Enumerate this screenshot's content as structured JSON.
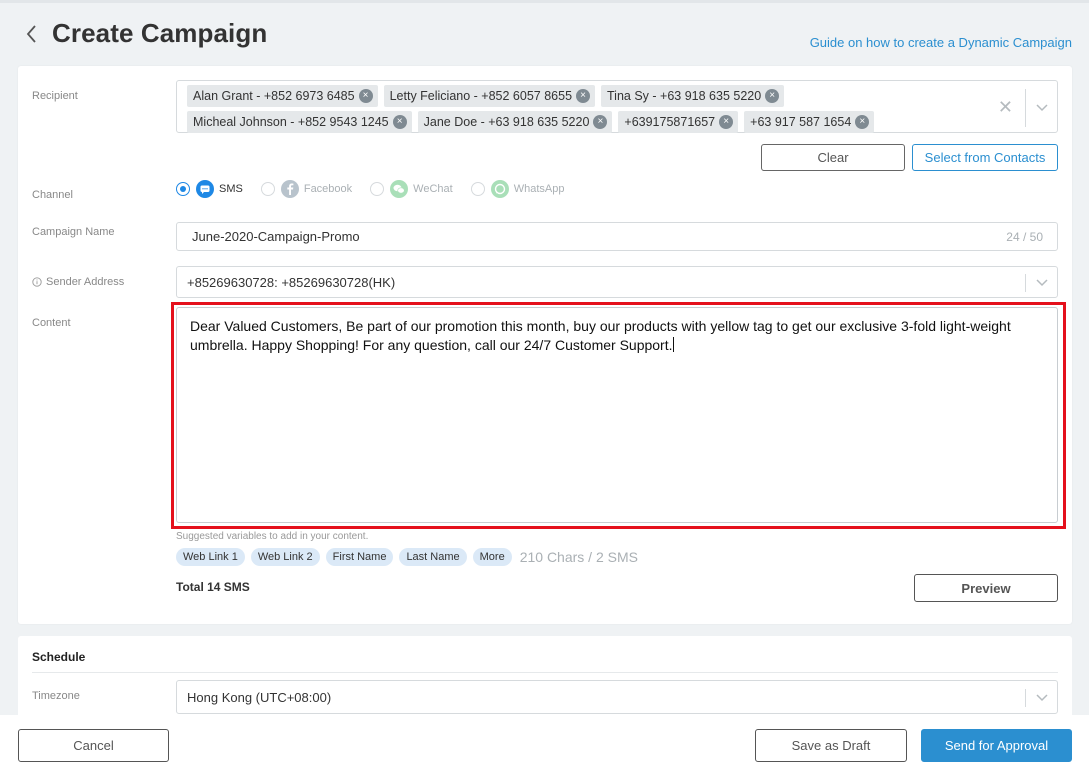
{
  "page": {
    "title": "Create Campaign",
    "guide_link": "Guide on how to create a Dynamic Campaign"
  },
  "recipient": {
    "label": "Recipient",
    "rows": [
      [
        "Alan Grant - +852 6973 6485",
        "Letty Feliciano - +852 6057 8655",
        "Tina Sy - +63 918 635 5220"
      ],
      [
        "Micheal Johnson - +852 9543 1245",
        "Jane Doe - +63 918 635 5220",
        "+639175871657",
        "+63 917 587 1654"
      ]
    ],
    "clear_button": "Clear",
    "select_contacts_button": "Select from Contacts"
  },
  "channel": {
    "label": "Channel",
    "options": [
      {
        "name": "SMS",
        "selected": true,
        "color": "#1e88e5"
      },
      {
        "name": "Facebook",
        "selected": false,
        "color": "#b8c3cc"
      },
      {
        "name": "WeChat",
        "selected": false,
        "color": "#a9dfb8"
      },
      {
        "name": "WhatsApp",
        "selected": false,
        "color": "#a9dfb8"
      }
    ]
  },
  "campaign_name": {
    "label": "Campaign Name",
    "value": "June-2020-Campaign-Promo",
    "counter": "24 / 50"
  },
  "sender": {
    "label": "Sender Address",
    "value": "+85269630728: +85269630728(HK)"
  },
  "content": {
    "label": "Content",
    "text": "Dear Valued Customers, Be part of our promotion this month, buy our products with yellow tag to get our exclusive 3-fold light-weight umbrella. Happy Shopping! For any question, call our 24/7 Customer Support.",
    "suggested_text": "Suggested variables to add in your content.",
    "variables": [
      "Web Link 1",
      "Web Link 2",
      "First Name",
      "Last Name",
      "More"
    ],
    "chars": "210 Chars / 2 SMS",
    "total": "Total 14 SMS",
    "preview_button": "Preview"
  },
  "schedule": {
    "title": "Schedule",
    "timezone_label": "Timezone",
    "timezone_value": "Hong Kong (UTC+08:00)"
  },
  "footer": {
    "cancel": "Cancel",
    "save_draft": "Save as Draft",
    "send": "Send for Approval"
  },
  "colors": {
    "accent": "#2b8fd0",
    "highlight": "#e4101c"
  }
}
